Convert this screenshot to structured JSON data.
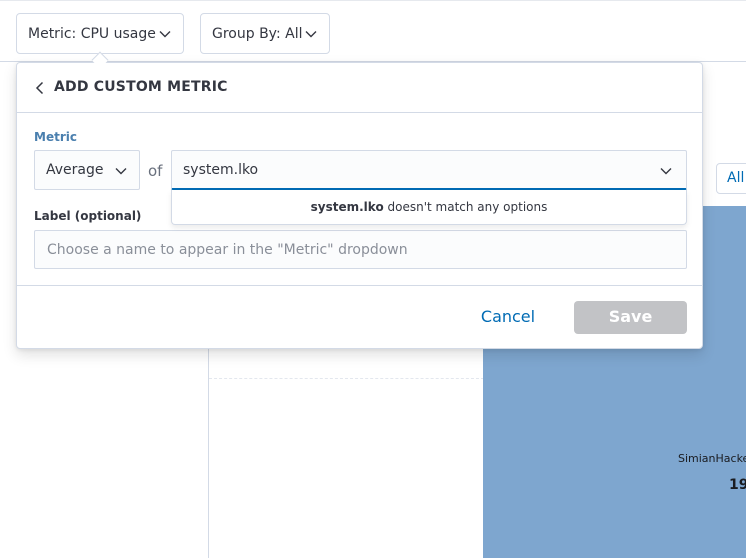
{
  "toolbar": {
    "metric_button": "Metric: CPU usage",
    "groupby_button": "Group By: All"
  },
  "background": {
    "all_button": "All",
    "treemap": {
      "color": "#7ea6cf",
      "node_name": "SimianHacke",
      "node_value": "19."
    }
  },
  "popover": {
    "title": "ADD CUSTOM METRIC",
    "metric_label": "Metric",
    "aggregation": "Average",
    "of_text": "of",
    "field_value": "system.lko",
    "no_match_term": "system.lko",
    "no_match_suffix": " doesn't match any options",
    "label_optional": "Label (optional)",
    "label_placeholder": "Choose a name to appear in the \"Metric\" dropdown",
    "cancel_label": "Cancel",
    "save_label": "Save"
  },
  "colors": {
    "accent": "#006bb4",
    "label_blue": "#4a7fae",
    "disabled_button": "#c2c3c6",
    "border": "#d3dae6"
  },
  "icons": {
    "back": "chevron-left-icon",
    "caret": "chevron-down-icon"
  }
}
